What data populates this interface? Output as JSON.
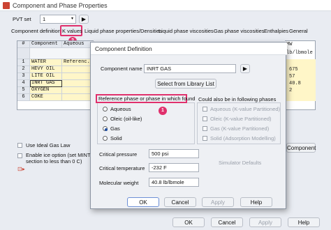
{
  "window": {
    "title": "Component and Phase Properties"
  },
  "pvt_set": {
    "label": "PVT set",
    "value": "1"
  },
  "tabs": [
    {
      "label": "Component definition"
    },
    {
      "label": "K values"
    },
    {
      "label": "Liquid phase properties/Densities"
    },
    {
      "label": "Liquid phase viscosities"
    },
    {
      "label": "Gas phase viscosities"
    },
    {
      "label": "Enthalpies"
    },
    {
      "label": "General"
    }
  ],
  "grid": {
    "headers": [
      "#",
      "Component",
      "Aqueous"
    ],
    "rows": [
      {
        "num": "1",
        "name": "WATER",
        "aq": "Referenc..."
      },
      {
        "num": "2",
        "name": "HEVY OIL",
        "aq": ""
      },
      {
        "num": "3",
        "name": "LITE OIL",
        "aq": ""
      },
      {
        "num": "4",
        "name": "INRT GAS",
        "aq": ""
      },
      {
        "num": "5",
        "name": "OXYGEN",
        "aq": ""
      },
      {
        "num": "6",
        "name": "COKE",
        "aq": ""
      }
    ],
    "right_header": "MW",
    "right_subheader": "lb/lbmole",
    "right_values": [
      "",
      "675",
      "57",
      "40.8",
      "2",
      ""
    ]
  },
  "left_bottom": {
    "ideal_gas_label": "Use Ideal Gas Law",
    "ice_label_1": "Enable ice option (set MINTEMP",
    "ice_label_2": "section to less than 0 C)"
  },
  "bg_component_button": "Component",
  "bottom_buttons": {
    "ok": "OK",
    "cancel": "Cancel",
    "apply": "Apply",
    "help": "Help"
  },
  "dialog": {
    "title": "Component Definition",
    "component_name_label": "Component name",
    "component_name_value": "INRT GAS",
    "select_library_button": "Select from Library List",
    "ref_phase_label": "Reference phase or phase in which found",
    "phases": [
      {
        "label": "Aqueous",
        "selected": false
      },
      {
        "label": "Oleic (oil-like)",
        "selected": false
      },
      {
        "label": "Gas",
        "selected": true
      },
      {
        "label": "Solid",
        "selected": false
      }
    ],
    "also_label": "Could also be in following phases",
    "also_phases": [
      {
        "label": "Aqueous (K-value Partitioned)"
      },
      {
        "label": "Oleic (K-value Partitioned)"
      },
      {
        "label": "Gas (K-value Partitioned)"
      },
      {
        "label": "Solid (Adsorption Modelling)"
      }
    ],
    "props": [
      {
        "label": "Critical pressure",
        "value": "500 psi"
      },
      {
        "label": "Critical temperature",
        "value": "-232 F"
      },
      {
        "label": "Molecular weight",
        "value": "40.8 lb/lbmole"
      }
    ],
    "simulator_defaults": "Simulator Defaults",
    "buttons": {
      "ok": "OK",
      "cancel": "Cancel",
      "apply": "Apply",
      "help": "Help"
    }
  },
  "annotations": {
    "badge1": "1",
    "badge2": "2"
  },
  "colors": {
    "highlight_box": "#e0306c",
    "accent": "#1f4ea3"
  }
}
